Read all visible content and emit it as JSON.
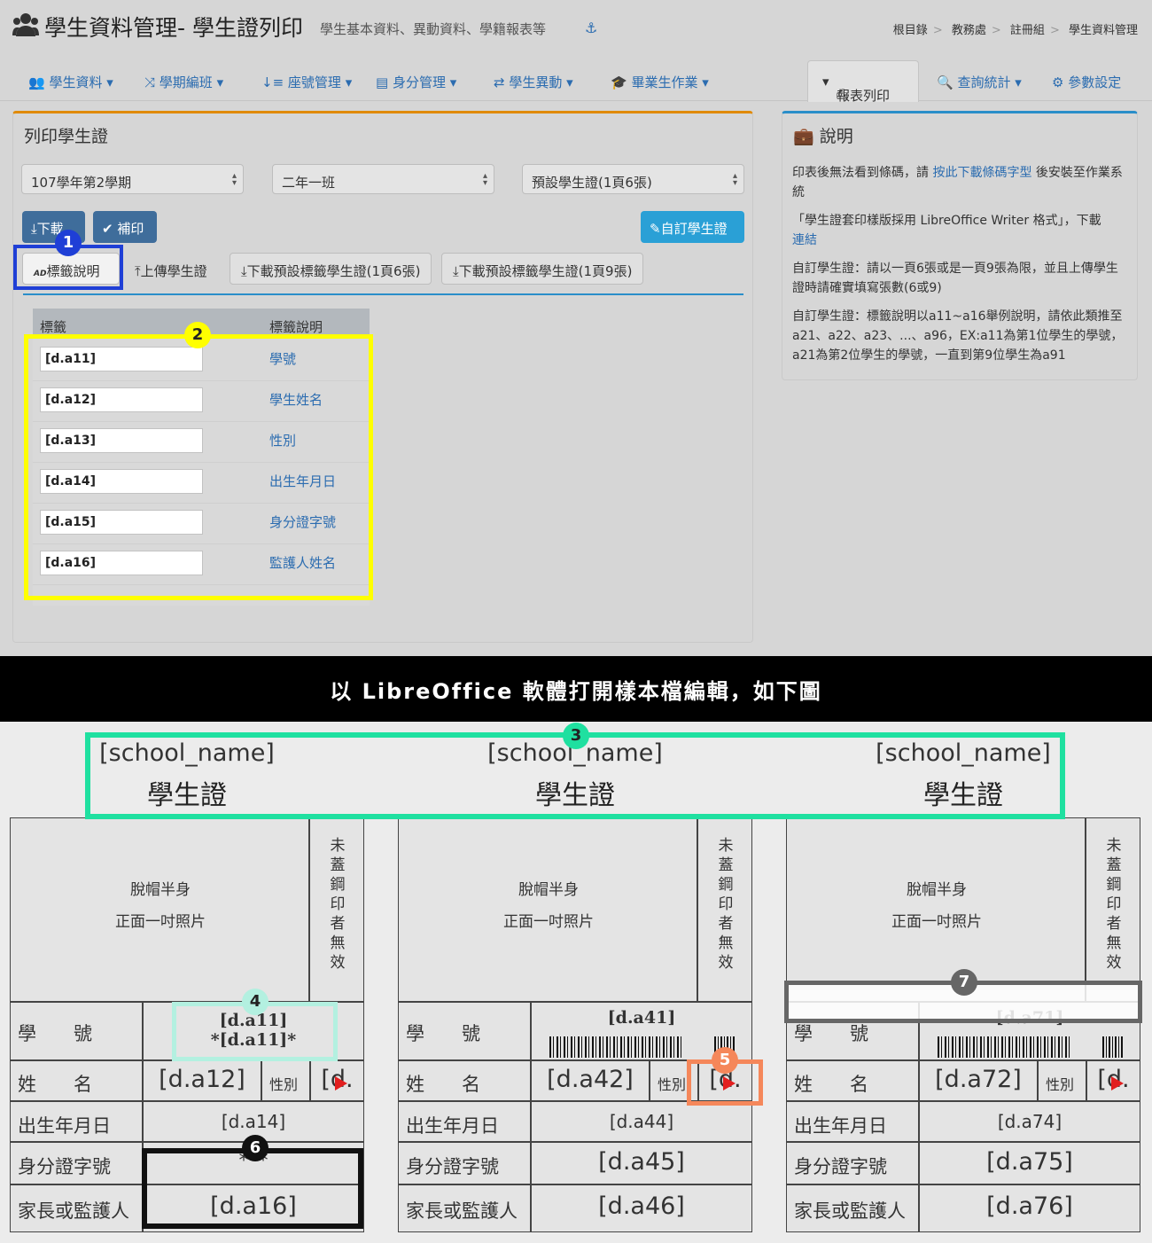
{
  "header": {
    "title": "學生資料管理- 學生證列印",
    "subtitle": "學生基本資料、異動資料、學籍報表等",
    "breadcrumb": [
      "根目錄",
      "教務處",
      "註冊組",
      "學生資料管理"
    ]
  },
  "nav": {
    "items": [
      "學生資料",
      "學期編班",
      "座號管理",
      "身分管理",
      "學生異動",
      "畢業生作業"
    ],
    "active": "報表列印",
    "query": "查詢統計",
    "settings": "參數設定"
  },
  "left_panel": {
    "title": "列印學生證",
    "selects": [
      "107學年第2學期",
      "二年一班",
      "預設學生證(1頁6張)"
    ],
    "download_btn": "下載",
    "reprint_btn": "補印",
    "custom_btn": "自訂學生證",
    "tabs": [
      "標籤說明",
      "上傳學生證",
      "下載預設標籤學生證(1頁6張)",
      "下載預設標籤學生證(1頁9張)"
    ],
    "table": {
      "headers": [
        "標籤",
        "標籤說明"
      ],
      "rows": [
        {
          "tag": "[d.a11]",
          "desc": "學號"
        },
        {
          "tag": "[d.a12]",
          "desc": "學生姓名"
        },
        {
          "tag": "[d.a13]",
          "desc": "性別"
        },
        {
          "tag": "[d.a14]",
          "desc": "出生年月日"
        },
        {
          "tag": "[d.a15]",
          "desc": "身分證字號"
        },
        {
          "tag": "[d.a16]",
          "desc": "監護人姓名"
        }
      ]
    }
  },
  "right_panel": {
    "title": "說明",
    "p1_before": "印表後無法看到條碼，請",
    "p1_link": "按此下載條碼字型",
    "p1_after": "後安裝至作業系統",
    "p2_text": "「學生證套印樣版採用 LibreOffice Writer 格式」，下載",
    "p2_link": "連結",
    "p3": "自訂學生證：請以一頁6張或是一頁9張為限，並且上傳學生證時請確實填寫張數(6或9)",
    "p4": "自訂學生證：標籤說明以a11~a16舉例說明，請依此類推至a21、a22、a23、...、a96，EX:a11為第1位學生的學號，a21為第2位學生的學號，一直到第9位學生為a91"
  },
  "band": {
    "text": "以 LibreOffice 軟體打開樣本檔編輯，如下圖"
  },
  "cards": [
    {
      "school": "[school_name]",
      "card_title": "學生證",
      "photo1": "脫帽半身",
      "photo2": "正面一吋照片",
      "stamp": "未蓋鋼印者無效",
      "id_label": "學　　號",
      "id_tag": "[d.a11]",
      "id_code": "*[d.a11]*",
      "name_label": "姓　　名",
      "name_val": "[d.a12]",
      "gender_label": "性別",
      "gender_val": "[d.",
      "birth_label": "出生年月日",
      "birth_val": "[d.a14]",
      "idn_label": "身分證字號",
      "idn_val": "***",
      "guard_label": "家長或監護人",
      "guard_val": "[d.a16]"
    },
    {
      "school": "[school_name]",
      "card_title": "學生證",
      "photo1": "脫帽半身",
      "photo2": "正面一吋照片",
      "stamp": "未蓋鋼印者無效",
      "id_label": "學　　號",
      "id_tag": "[d.a41]",
      "name_label": "姓　　名",
      "name_val": "[d.a42]",
      "gender_label": "性別",
      "gender_val": "[d.",
      "birth_label": "出生年月日",
      "birth_val": "[d.a44]",
      "idn_label": "身分證字號",
      "idn_val": "[d.a45]",
      "guard_label": "家長或監護人",
      "guard_val": "[d.a46]"
    },
    {
      "school": "[school_name]",
      "card_title": "學生證",
      "photo1": "脫帽半身",
      "photo2": "正面一吋照片",
      "stamp": "未蓋鋼印者無效",
      "id_label": "學　　號",
      "id_tag": "[d.a71]",
      "name_label": "姓　　名",
      "name_val": "[d.a72]",
      "gender_label": "性別",
      "gender_val": "[d.",
      "birth_label": "出生年月日",
      "birth_val": "[d.a74]",
      "idn_label": "身分證字號",
      "idn_val": "[d.a75]",
      "guard_label": "家長或監護人",
      "guard_val": "[d.a76]"
    }
  ],
  "markers": [
    "1",
    "2",
    "3",
    "4",
    "5",
    "6",
    "7"
  ],
  "colors": {
    "marker1": "#1f3fd6",
    "marker2": "#ffff00",
    "marker3": "#1fe0a0",
    "marker4": "#b3f0e0",
    "marker5": "#f5875a",
    "marker6": "#111111",
    "marker7": "#666666"
  }
}
